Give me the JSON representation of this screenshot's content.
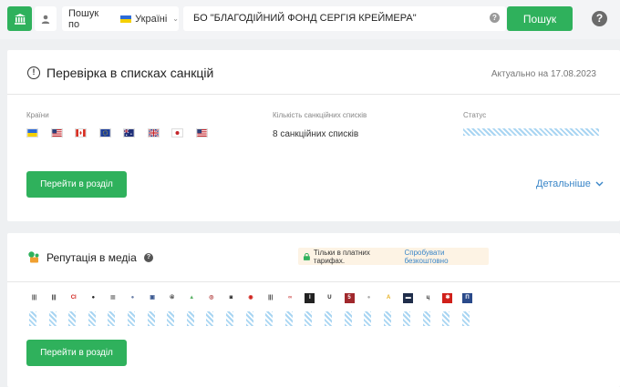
{
  "topbar": {
    "search_by_label": "Пошук по",
    "search_by_value": "Україні",
    "search_query": "БО \"БЛАГОДІЙНИЙ ФОНД СЕРГІЯ КРЕЙМЕРА\"",
    "search_button": "Пошук",
    "help_glyph": "?",
    "icons": [
      "institution-icon",
      "user-icon",
      "chevron-down-icon",
      "help-icon"
    ],
    "accent_color": "#2fb15c"
  },
  "sanctions": {
    "title": "Перевірка в списках санкцій",
    "updated": "Актуально на 17.08.2023",
    "countries_label": "Країни",
    "lists_label": "Кількість санкційних списків",
    "lists_value": "8 санкційних списків",
    "status_label": "Статус",
    "flags": [
      "ua",
      "us",
      "ca",
      "eu",
      "au",
      "gb",
      "jp",
      "us"
    ],
    "go_button": "Перейти в розділ",
    "details_link": "Детальніше"
  },
  "media": {
    "title": "Репутація в медіа",
    "paid_note": "Тільки в платних тарифах.",
    "paid_link": "Спробувати безкоштовно",
    "logos": [
      {
        "t": "|||",
        "bg": "#fff",
        "fg": "#222"
      },
      {
        "t": "|||",
        "bg": "#fff",
        "fg": "#222"
      },
      {
        "t": "CI",
        "bg": "#fff",
        "fg": "#d0201a"
      },
      {
        "t": "●",
        "bg": "#fff",
        "fg": "#222"
      },
      {
        "t": "▦",
        "bg": "#fff",
        "fg": "#999"
      },
      {
        "t": "●",
        "bg": "#fff",
        "fg": "#6a7fa8"
      },
      {
        "t": "▣",
        "bg": "#fff",
        "fg": "#3a5890"
      },
      {
        "t": "④",
        "bg": "#fff",
        "fg": "#333"
      },
      {
        "t": "▲",
        "bg": "#fff",
        "fg": "#5ab265"
      },
      {
        "t": "◎",
        "bg": "#fff",
        "fg": "#b03a3a"
      },
      {
        "t": "◙",
        "bg": "#fff",
        "fg": "#222"
      },
      {
        "t": "◉",
        "bg": "#fff",
        "fg": "#d0201a"
      },
      {
        "t": "|||",
        "bg": "#fff",
        "fg": "#222"
      },
      {
        "t": "∞",
        "bg": "#fff",
        "fg": "#d05050"
      },
      {
        "t": "I",
        "bg": "#222",
        "fg": "#fff"
      },
      {
        "t": "U",
        "bg": "#fff",
        "fg": "#222"
      },
      {
        "t": "5",
        "bg": "#a0282c",
        "fg": "#fff"
      },
      {
        "t": "●",
        "bg": "#fff",
        "fg": "#aaa"
      },
      {
        "t": "A",
        "bg": "#fff",
        "fg": "#e6b020"
      },
      {
        "t": "▬",
        "bg": "#1f2d4a",
        "fg": "#fff"
      },
      {
        "t": "ц",
        "bg": "#fff",
        "fg": "#333"
      },
      {
        "t": "✱",
        "bg": "#d0201a",
        "fg": "#fff"
      },
      {
        "t": "П",
        "bg": "#2a4a8a",
        "fg": "#fff"
      }
    ],
    "go_button": "Перейти в розділ"
  }
}
